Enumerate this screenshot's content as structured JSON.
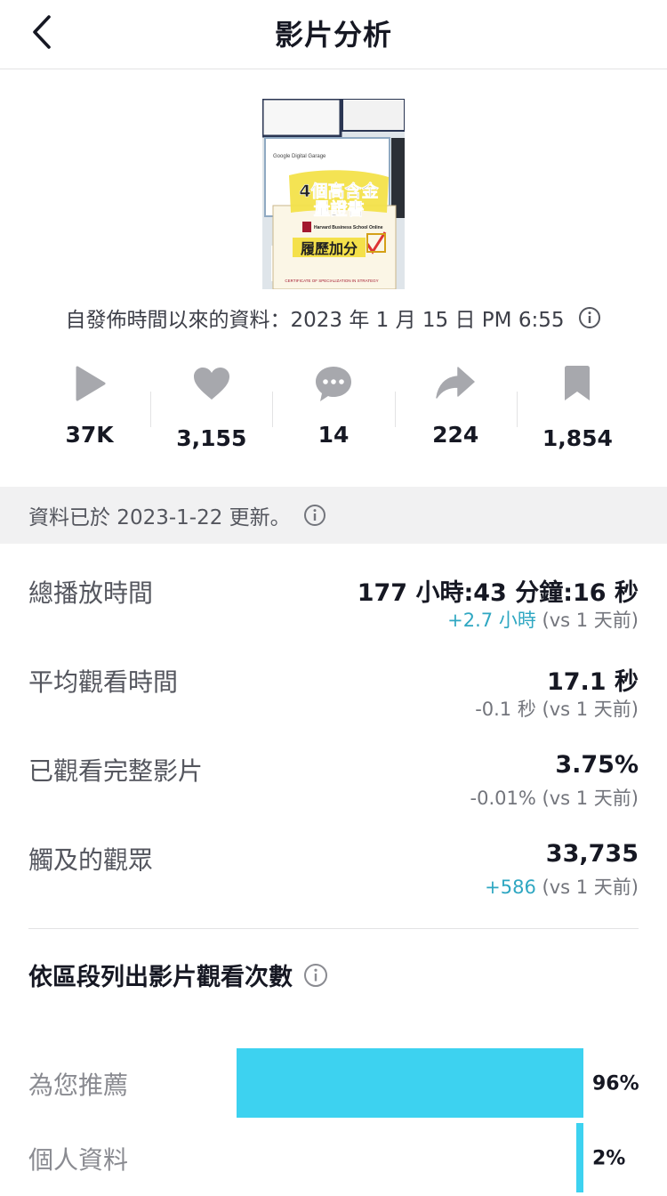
{
  "header": {
    "title": "影片分析"
  },
  "thumbnail": {
    "line1": "4個高含金",
    "line2": "量證書",
    "line3": "履歷加分",
    "google_label": "Google Digital Garage",
    "harvard_label": "Harvard Business School Online",
    "cert_label": "CERTIFICATE OF SPECIALIZATION IN STRATEGY"
  },
  "published_text": "自發佈時間以來的資料：2023 年 1 月 15 日 PM 6:55",
  "stats": [
    {
      "icon": "play-icon",
      "value": "37K"
    },
    {
      "icon": "heart-icon",
      "value": "3,155"
    },
    {
      "icon": "comment-icon",
      "value": "14"
    },
    {
      "icon": "share-icon",
      "value": "224"
    },
    {
      "icon": "bookmark-icon",
      "value": "1,854"
    }
  ],
  "updated_text": "資料已於 2023-1-22 更新。",
  "metrics": [
    {
      "label": "總播放時間",
      "value": "177 小時:43 分鐘:16 秒",
      "delta": "+2.7 小時",
      "delta_suffix": " (vs 1 天前)",
      "delta_color": "#2fa7c2"
    },
    {
      "label": "平均觀看時間",
      "value": "17.1 秒",
      "delta": "-0.1 秒",
      "delta_suffix": " (vs 1 天前)",
      "delta_color": "#73757c"
    },
    {
      "label": "已觀看完整影片",
      "value": "3.75%",
      "delta": "-0.01%",
      "delta_suffix": " (vs 1 天前)",
      "delta_color": "#73757c"
    },
    {
      "label": "觸及的觀眾",
      "value": "33,735",
      "delta": "+586",
      "delta_suffix": " (vs 1 天前)",
      "delta_color": "#2fa7c2"
    }
  ],
  "section": {
    "title": "依區段列出影片觀看次數"
  },
  "traffic_sources": [
    {
      "label": "為您推薦",
      "percent_label": "96%",
      "fraction": 0.96
    },
    {
      "label": "個人資料",
      "percent_label": "2%",
      "fraction": 0.02
    }
  ],
  "colors": {
    "accent": "#3dd2f0",
    "positive": "#2fa7c2",
    "icon": "#a7a8ad"
  }
}
